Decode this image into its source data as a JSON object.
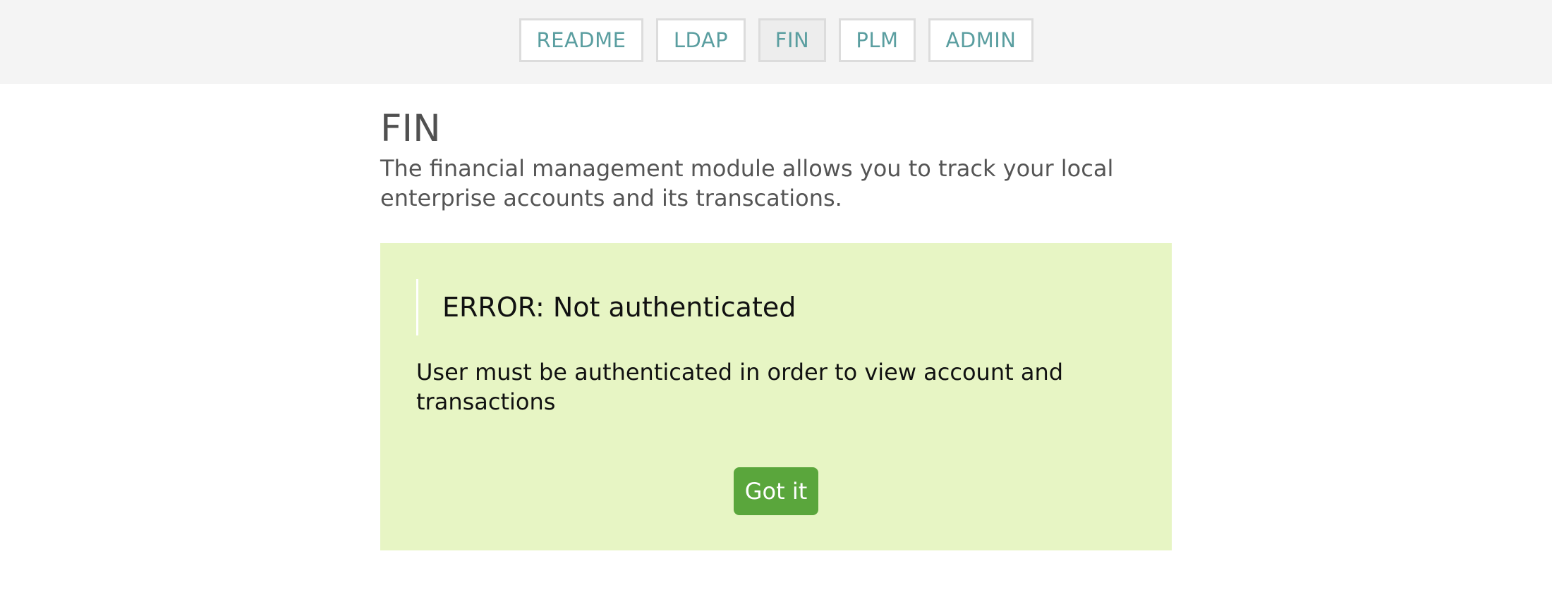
{
  "nav": {
    "items": [
      {
        "label": "README",
        "active": false
      },
      {
        "label": "LDAP",
        "active": false
      },
      {
        "label": "FIN",
        "active": true
      },
      {
        "label": "PLM",
        "active": false
      },
      {
        "label": "ADMIN",
        "active": false
      }
    ]
  },
  "main": {
    "title": "FIN",
    "description": "The financial management module allows you to track your local enterprise accounts and its transcations."
  },
  "alert": {
    "heading": "ERROR: Not authenticated",
    "message": "User must be authenticated in order to view account and transactions",
    "button_label": "Got it"
  },
  "colors": {
    "topbar_bg": "#f4f4f4",
    "nav_text": "#5a9ea0",
    "alert_bg": "#e7f5c4",
    "button_bg": "#5aa63c"
  }
}
